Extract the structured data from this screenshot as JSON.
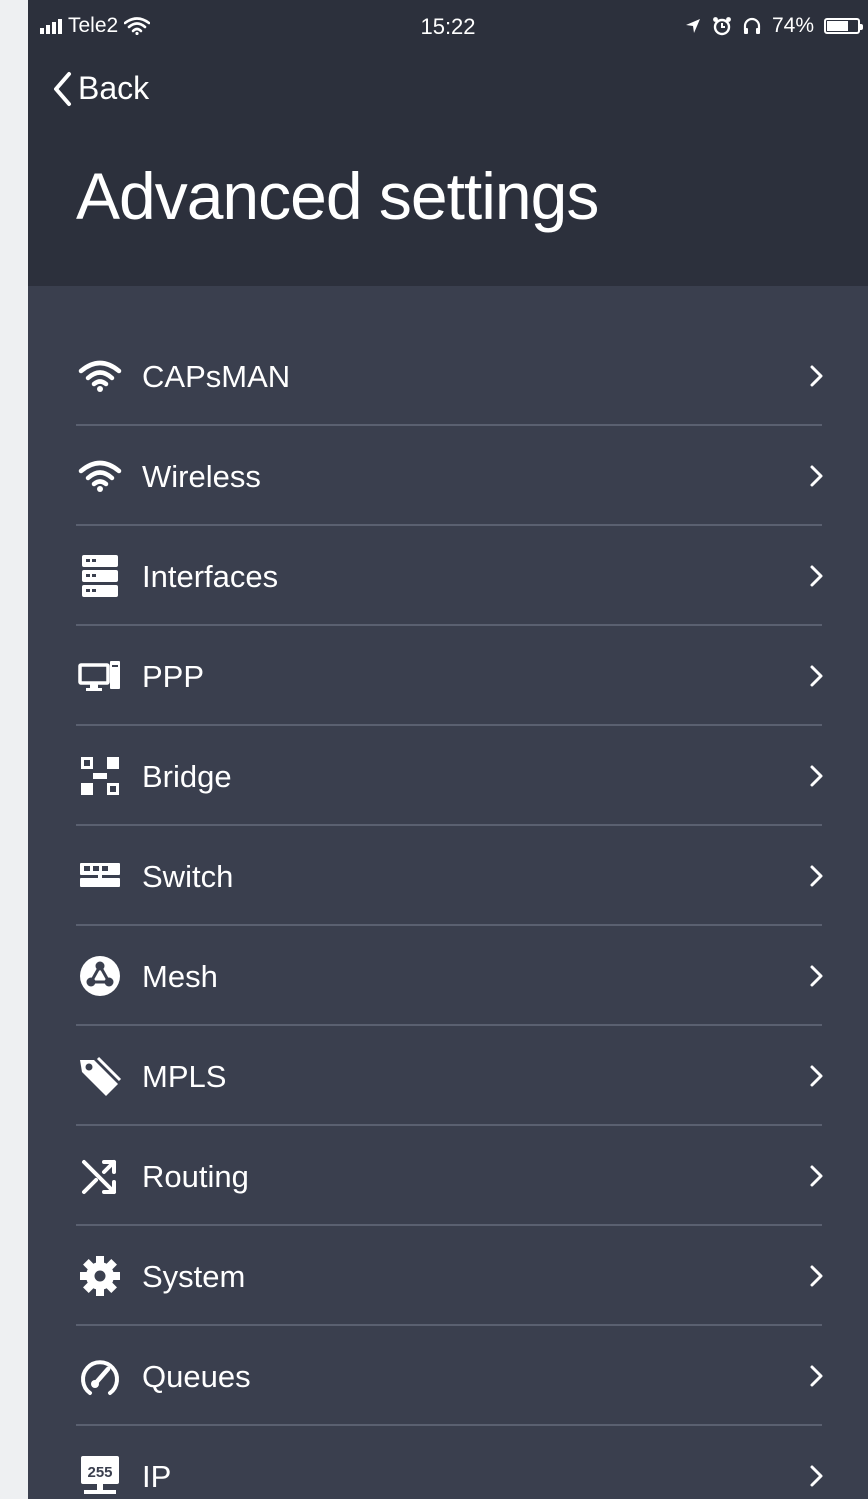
{
  "status_bar": {
    "carrier": "Tele2",
    "time": "15:22",
    "battery_percent": "74%",
    "battery_level": 0.74
  },
  "nav": {
    "back_label": "Back"
  },
  "page": {
    "title": "Advanced settings"
  },
  "colors": {
    "header_bg": "#2c303c",
    "list_bg": "#3a3f4e",
    "divider": "#5a6070",
    "text": "#ffffff"
  },
  "menu": [
    {
      "label": "CAPsMAN",
      "icon": "wifi-icon"
    },
    {
      "label": "Wireless",
      "icon": "wifi-icon"
    },
    {
      "label": "Interfaces",
      "icon": "server-icon"
    },
    {
      "label": "PPP",
      "icon": "ppp-icon"
    },
    {
      "label": "Bridge",
      "icon": "bridge-icon"
    },
    {
      "label": "Switch",
      "icon": "switch-icon"
    },
    {
      "label": "Mesh",
      "icon": "mesh-icon"
    },
    {
      "label": "MPLS",
      "icon": "tag-icon"
    },
    {
      "label": "Routing",
      "icon": "routing-icon"
    },
    {
      "label": "System",
      "icon": "gear-icon"
    },
    {
      "label": "Queues",
      "icon": "gauge-icon"
    },
    {
      "label": "IP",
      "icon": "ip-icon"
    }
  ]
}
